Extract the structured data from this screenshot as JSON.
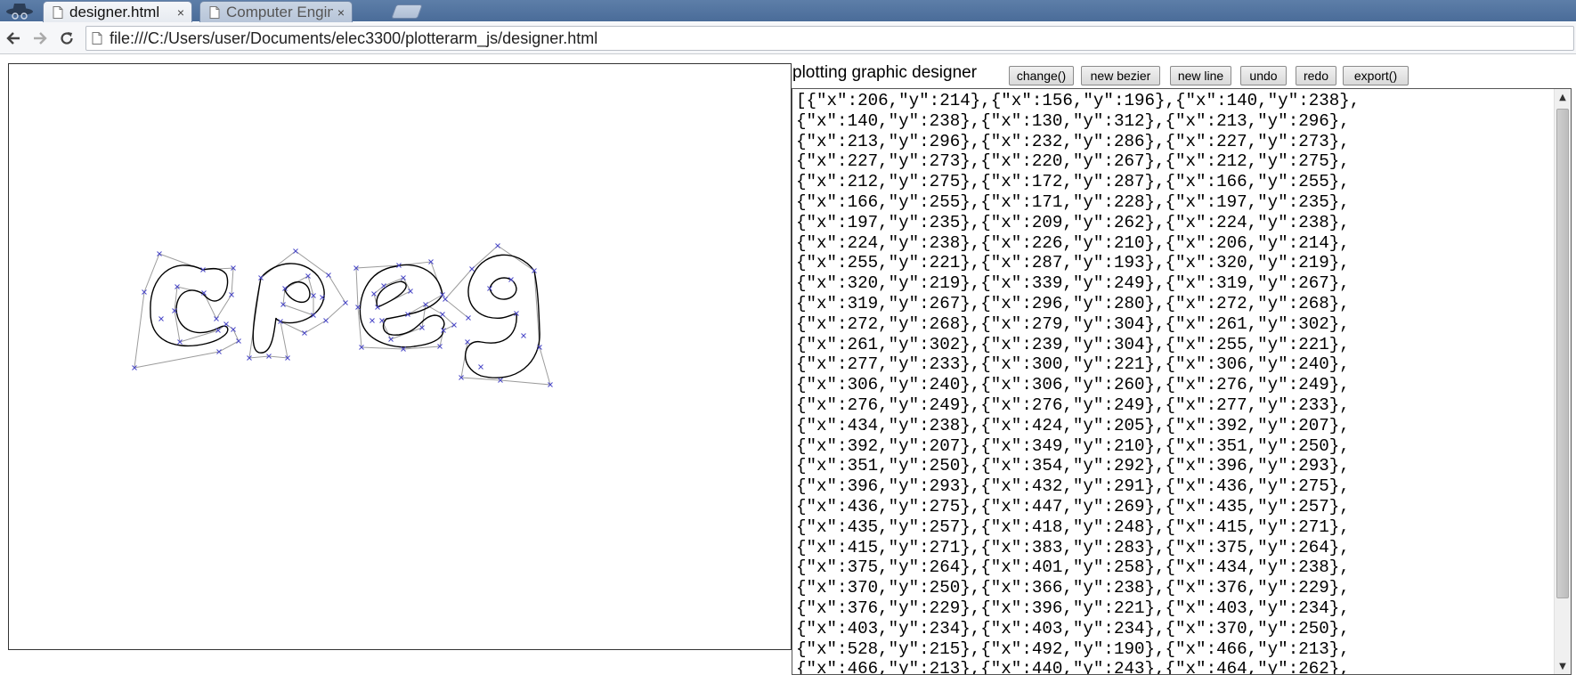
{
  "browser": {
    "tabs": [
      {
        "title": "designer.html",
        "close": "×",
        "active": true
      },
      {
        "title": "Computer Engin",
        "close": "×",
        "active": false
      }
    ],
    "url": "file:///C:/Users/user/Documents/elec3300/plotterarm_js/designer.html"
  },
  "page": {
    "heading": "plotting graphic designer",
    "buttons": {
      "change": "change()",
      "new_bezier": "new bezier",
      "new_line": "new line",
      "undo": "undo",
      "redo": "redo",
      "export": "export()"
    },
    "json_lines": [
      "[{\"x\":206,\"y\":214},{\"x\":156,\"y\":196},{\"x\":140,\"y\":238},",
      "{\"x\":140,\"y\":238},{\"x\":130,\"y\":312},{\"x\":213,\"y\":296},",
      "{\"x\":213,\"y\":296},{\"x\":232,\"y\":286},{\"x\":227,\"y\":273},",
      "{\"x\":227,\"y\":273},{\"x\":220,\"y\":267},{\"x\":212,\"y\":275},",
      "{\"x\":212,\"y\":275},{\"x\":172,\"y\":287},{\"x\":166,\"y\":255},",
      "{\"x\":166,\"y\":255},{\"x\":171,\"y\":228},{\"x\":197,\"y\":235},",
      "{\"x\":197,\"y\":235},{\"x\":209,\"y\":262},{\"x\":224,\"y\":238},",
      "{\"x\":224,\"y\":238},{\"x\":226,\"y\":210},{\"x\":206,\"y\":214},",
      "{\"x\":255,\"y\":221},{\"x\":287,\"y\":193},{\"x\":320,\"y\":219},",
      "{\"x\":320,\"y\":219},{\"x\":339,\"y\":249},{\"x\":319,\"y\":267},",
      "{\"x\":319,\"y\":267},{\"x\":296,\"y\":280},{\"x\":272,\"y\":268},",
      "{\"x\":272,\"y\":268},{\"x\":279,\"y\":304},{\"x\":261,\"y\":302},",
      "{\"x\":261,\"y\":302},{\"x\":239,\"y\":304},{\"x\":255,\"y\":221},",
      "{\"x\":277,\"y\":233},{\"x\":300,\"y\":221},{\"x\":306,\"y\":240},",
      "{\"x\":306,\"y\":240},{\"x\":306,\"y\":260},{\"x\":276,\"y\":249},",
      "{\"x\":276,\"y\":249},{\"x\":276,\"y\":249},{\"x\":277,\"y\":233},",
      "{\"x\":434,\"y\":238},{\"x\":424,\"y\":205},{\"x\":392,\"y\":207},",
      "{\"x\":392,\"y\":207},{\"x\":349,\"y\":210},{\"x\":351,\"y\":250},",
      "{\"x\":351,\"y\":250},{\"x\":354,\"y\":292},{\"x\":396,\"y\":293},",
      "{\"x\":396,\"y\":293},{\"x\":432,\"y\":291},{\"x\":436,\"y\":275},",
      "{\"x\":436,\"y\":275},{\"x\":447,\"y\":269},{\"x\":435,\"y\":257},",
      "{\"x\":435,\"y\":257},{\"x\":418,\"y\":248},{\"x\":415,\"y\":271},",
      "{\"x\":415,\"y\":271},{\"x\":383,\"y\":283},{\"x\":375,\"y\":264},",
      "{\"x\":375,\"y\":264},{\"x\":401,\"y\":258},{\"x\":434,\"y\":238},",
      "{\"x\":370,\"y\":250},{\"x\":366,\"y\":238},{\"x\":376,\"y\":229},",
      "{\"x\":376,\"y\":229},{\"x\":396,\"y\":221},{\"x\":403,\"y\":234},",
      "{\"x\":403,\"y\":234},{\"x\":403,\"y\":234},{\"x\":370,\"y\":250},",
      "{\"x\":528,\"y\":215},{\"x\":492,\"y\":190},{\"x\":466,\"y\":213},",
      "{\"x\":466,\"y\":213},{\"x\":440,\"y\":243},{\"x\":464,\"y\":262},"
    ]
  }
}
